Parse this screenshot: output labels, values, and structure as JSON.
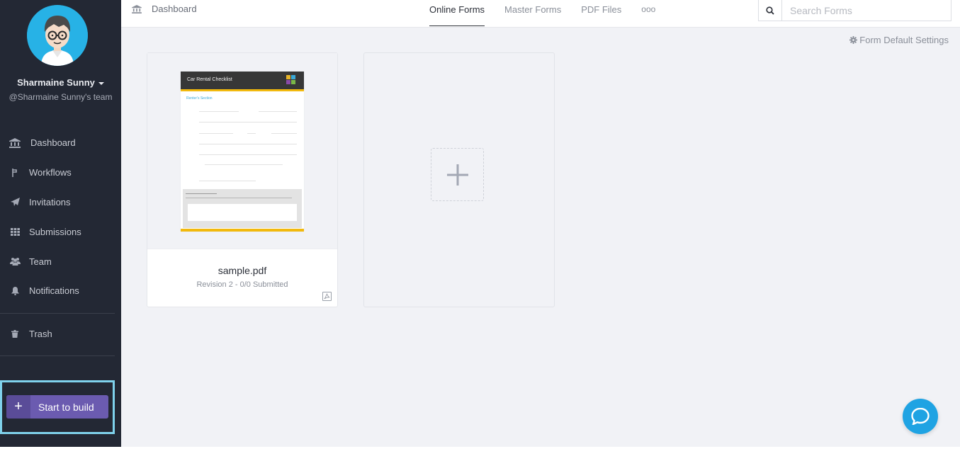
{
  "user": {
    "name": "Sharmaine Sunny",
    "team": "@Sharmaine Sunny's team"
  },
  "sidebar": {
    "items": [
      {
        "label": "Dashboard",
        "icon": "bank-icon"
      },
      {
        "label": "Workflows",
        "icon": "workflow-icon"
      },
      {
        "label": "Invitations",
        "icon": "paper-plane-icon"
      },
      {
        "label": "Submissions",
        "icon": "grid-icon"
      },
      {
        "label": "Team",
        "icon": "users-icon"
      },
      {
        "label": "Notifications",
        "icon": "bell-icon"
      }
    ],
    "trash": {
      "label": "Trash",
      "icon": "trash-icon"
    },
    "build_button": "Start to build"
  },
  "topbar": {
    "breadcrumb": "Dashboard",
    "tabs": [
      {
        "label": "Online Forms",
        "active": true
      },
      {
        "label": "Master Forms",
        "active": false
      },
      {
        "label": "PDF Files",
        "active": false
      },
      {
        "label": "ooo",
        "active": false
      }
    ],
    "search_placeholder": "Search Forms"
  },
  "main": {
    "settings_label": "Form Default Settings",
    "forms": [
      {
        "name": "sample.pdf",
        "meta": "Revision 2 - 0/0 Submitted",
        "preview_title": "Car Rental Checklist",
        "preview_section": "Renter's Section"
      }
    ]
  },
  "colors": {
    "sidebar_bg": "#232834",
    "accent_purple": "#6b5bb0",
    "highlight_border": "#7fd2ec",
    "chat_blue": "#1fa3e3",
    "avatar_blue": "#27b2e6"
  }
}
